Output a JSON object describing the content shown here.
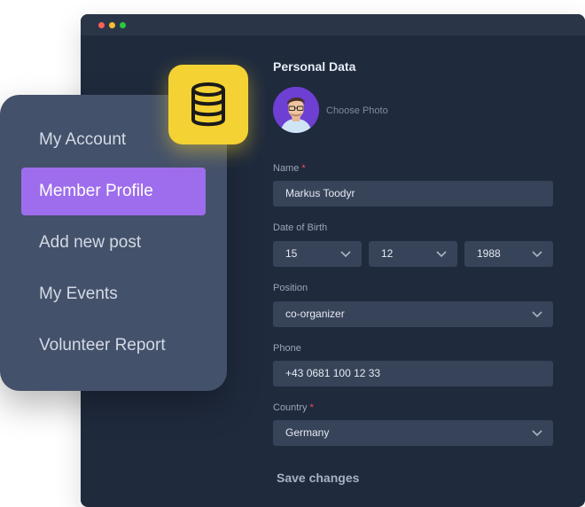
{
  "window": {
    "controls": [
      "close",
      "minimize",
      "maximize"
    ]
  },
  "badge": {
    "icon": "database-icon",
    "color": "#f4d233"
  },
  "sidebar": {
    "items": [
      {
        "label": "My Account",
        "active": false
      },
      {
        "label": "Member Profile",
        "active": true
      },
      {
        "label": "Add new post",
        "active": false
      },
      {
        "label": "My Events",
        "active": false
      },
      {
        "label": "Volunteer Report",
        "active": false
      }
    ],
    "accent": "#9d6ded"
  },
  "form": {
    "title": "Personal Data",
    "choose_photo": "Choose Photo",
    "name": {
      "label": "Name",
      "required": "*",
      "value": "Markus Toodyr"
    },
    "dob": {
      "label": "Date of Birth",
      "day": "15",
      "month": "12",
      "year": "1988"
    },
    "position": {
      "label": "Position",
      "value": "co-organizer"
    },
    "phone": {
      "label": "Phone",
      "value": "+43 0681 100 12 33"
    },
    "country": {
      "label": "Country",
      "required": "*",
      "value": "Germany"
    },
    "save_label": "Save changes"
  }
}
